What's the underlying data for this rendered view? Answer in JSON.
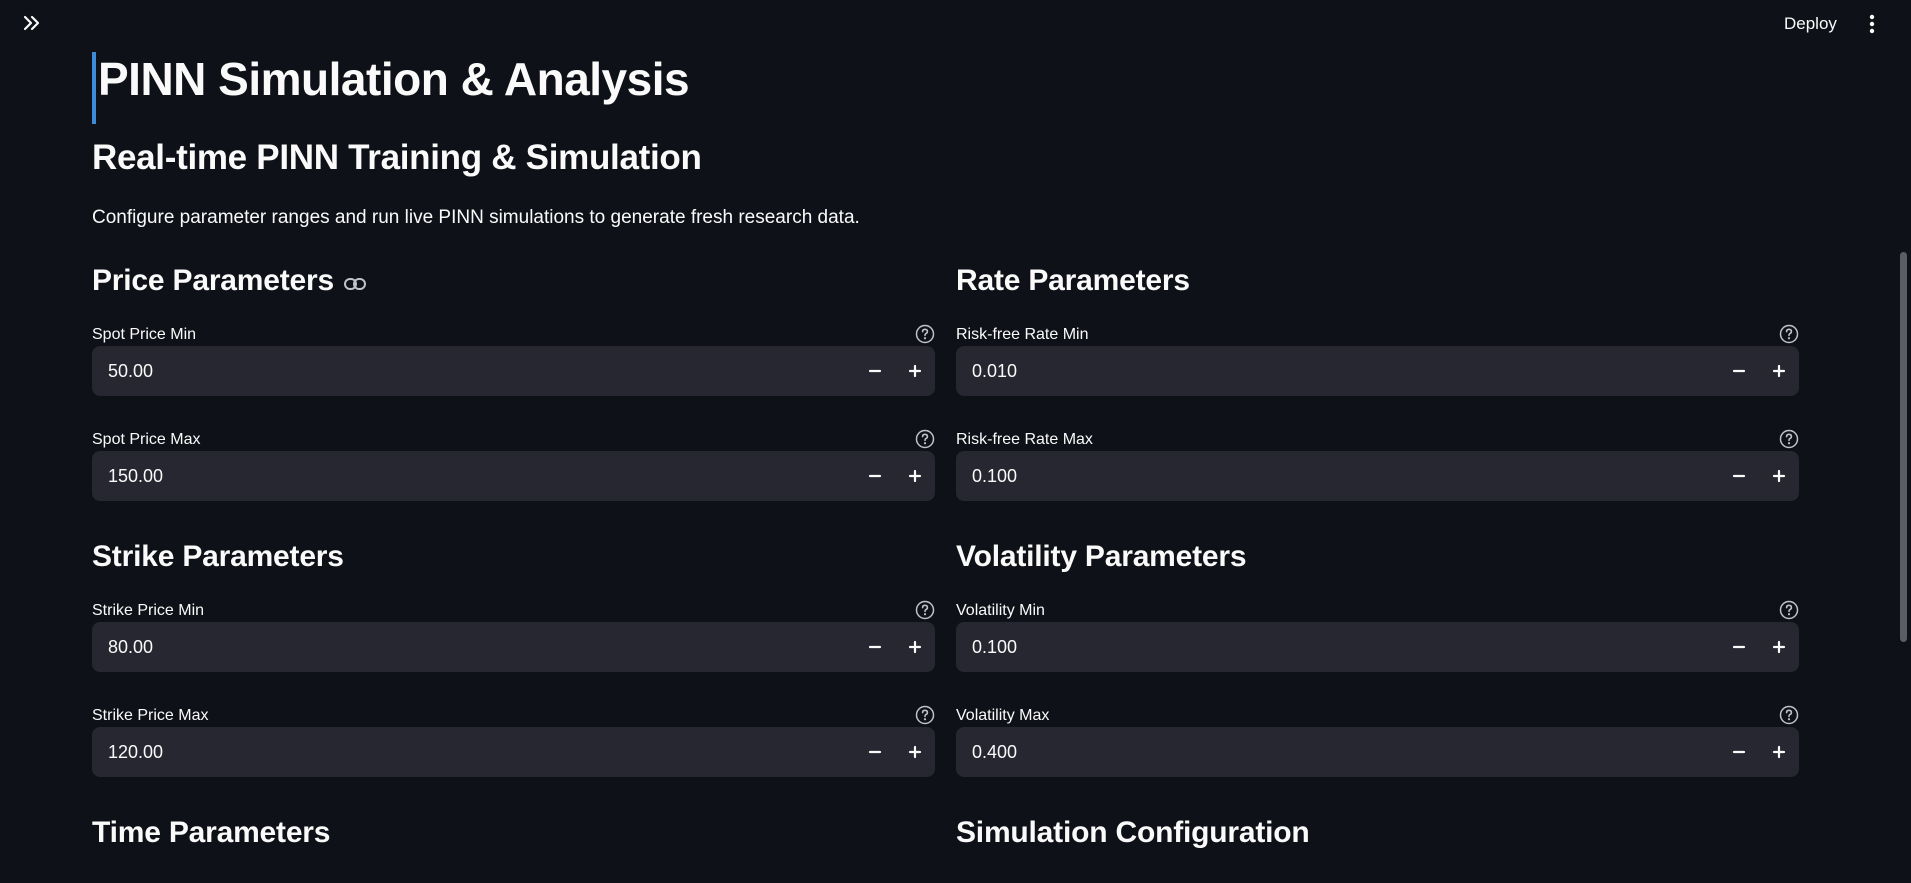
{
  "header": {
    "deploy_label": "Deploy"
  },
  "page": {
    "title": "PINN Simulation & Analysis",
    "subheader": "Real-time PINN Training & Simulation",
    "description": "Configure parameter ranges and run live PINN simulations to generate fresh research data."
  },
  "sections": {
    "price": {
      "title": "Price Parameters"
    },
    "rate": {
      "title": "Rate Parameters"
    },
    "strike": {
      "title": "Strike Parameters"
    },
    "volatility": {
      "title": "Volatility Parameters"
    },
    "time": {
      "title": "Time Parameters"
    },
    "simulation": {
      "title": "Simulation Configuration"
    }
  },
  "fields": {
    "spot_min": {
      "label": "Spot Price Min",
      "value": "50.00"
    },
    "spot_max": {
      "label": "Spot Price Max",
      "value": "150.00"
    },
    "rate_min": {
      "label": "Risk-free Rate Min",
      "value": "0.010"
    },
    "rate_max": {
      "label": "Risk-free Rate Max",
      "value": "0.100"
    },
    "strike_min": {
      "label": "Strike Price Min",
      "value": "80.00"
    },
    "strike_max": {
      "label": "Strike Price Max",
      "value": "120.00"
    },
    "vol_min": {
      "label": "Volatility Min",
      "value": "0.100"
    },
    "vol_max": {
      "label": "Volatility Max",
      "value": "0.400"
    }
  },
  "colors": {
    "background": "#0e1117",
    "input_background": "#262730",
    "title_accent": "#3d8bd9"
  }
}
